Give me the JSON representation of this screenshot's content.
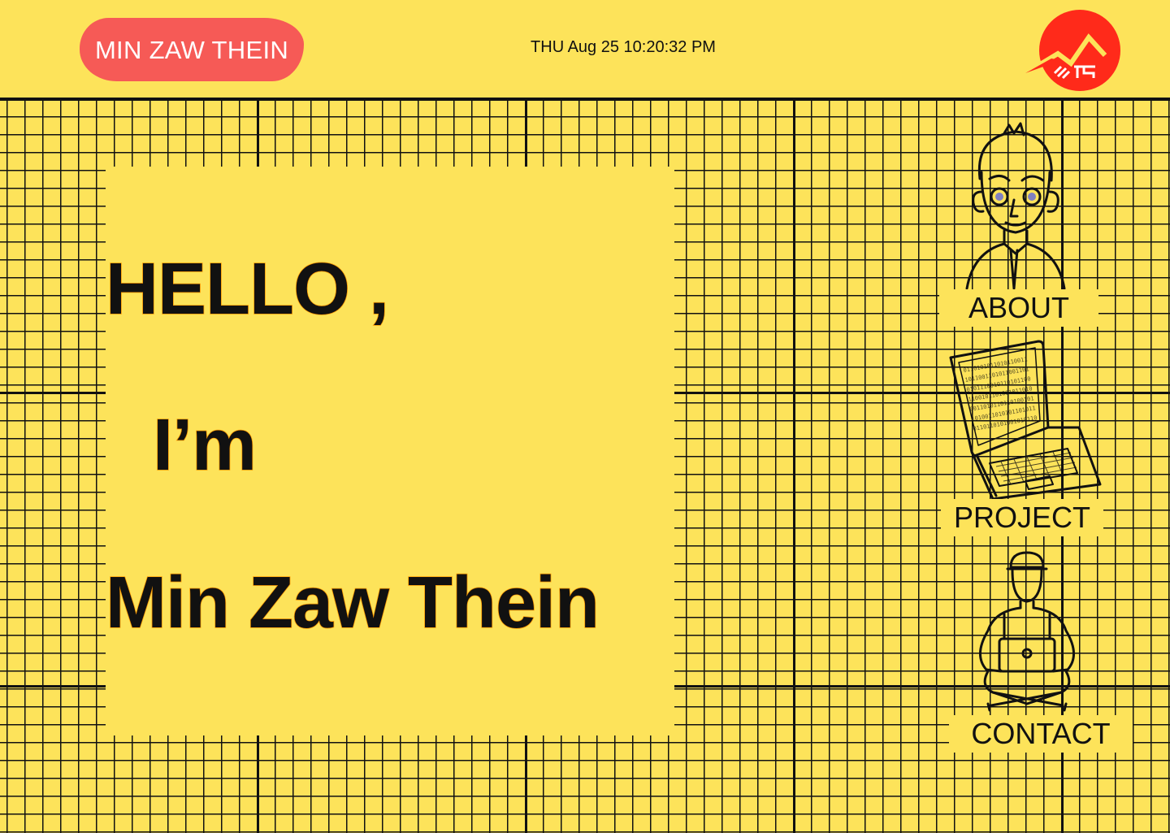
{
  "header": {
    "name_badge": "MIN ZAW THEIN",
    "datetime": "THU Aug 25 10:20:32 PM",
    "logo_icon": "mountain-logo-icon"
  },
  "hero": {
    "greeting": "HELLO ,",
    "intro": "I’m",
    "name": "Min Zaw Thein"
  },
  "nav": {
    "about": {
      "label": "ABOUT",
      "icon": "person-avatar-icon"
    },
    "project": {
      "label": "PROJECT",
      "icon": "laptop-icon"
    },
    "contact": {
      "label": "CONTACT",
      "icon": "person-with-laptop-icon"
    }
  },
  "colors": {
    "background": "#fde35a",
    "badge": "#f65a56",
    "logo": "#ff2a1a",
    "text_outline": "#ff9a00"
  }
}
